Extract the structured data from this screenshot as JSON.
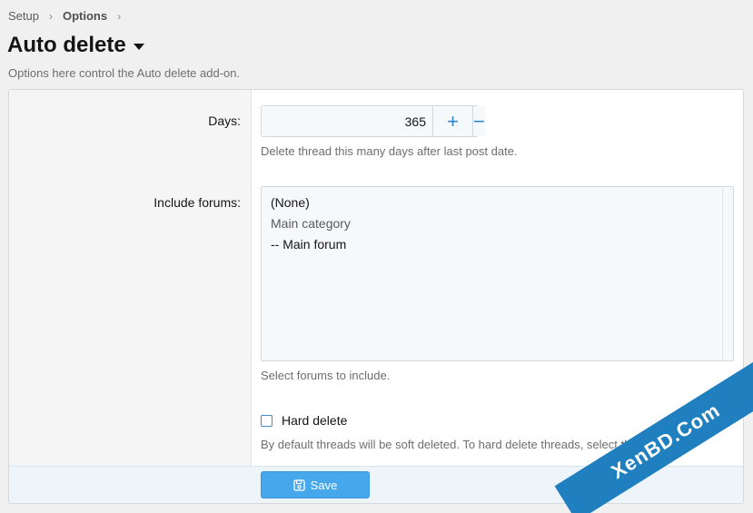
{
  "breadcrumb": {
    "items": [
      "Setup",
      "Options"
    ],
    "separator": "›"
  },
  "page": {
    "title": "Auto delete",
    "description": "Options here control the Auto delete add-on."
  },
  "form": {
    "days": {
      "label": "Days:",
      "value": "365",
      "increment": "+",
      "decrement": "−",
      "hint": "Delete thread this many days after last post date."
    },
    "include_forums": {
      "label": "Include forums:",
      "options": [
        "(None)",
        "Main category",
        "-- Main forum"
      ],
      "hint": "Select forums to include."
    },
    "hard_delete": {
      "label": "Hard delete",
      "checked": false,
      "hint": "By default threads will be soft deleted. To hard delete threads, select this option."
    },
    "save_label": "Save"
  },
  "watermark": "XenBD.Com",
  "colors": {
    "accent": "#47a7eb",
    "link": "#2f86c7",
    "footer": "#edf4fa",
    "watermark": "#1f7fbf"
  }
}
